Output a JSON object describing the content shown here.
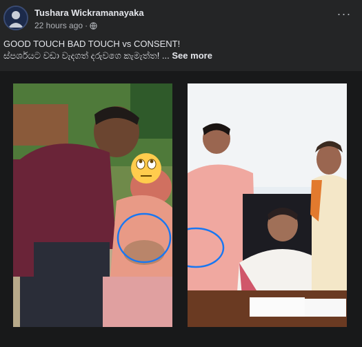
{
  "post": {
    "author": "Tushara Wickramanayaka",
    "time": "22 hours ago",
    "separator": "·",
    "caption_line1": "GOOD TOUCH BAD TOUCH vs CONSENT!",
    "caption_line2": "ස්පර්ශයට වඩා වැදගත් දරුවගෙ කැමැත්ත! ...",
    "see_more": "See more",
    "more_options": "···"
  },
  "icons": {
    "audience": "globe-icon",
    "more": "more-options-icon",
    "emoji": "rolling-eyes-emoji-icon"
  },
  "colors": {
    "background": "#242526",
    "text_primary": "#e4e6eb",
    "text_secondary": "#b0b3b8",
    "circle_annotation": "#1877f2"
  }
}
